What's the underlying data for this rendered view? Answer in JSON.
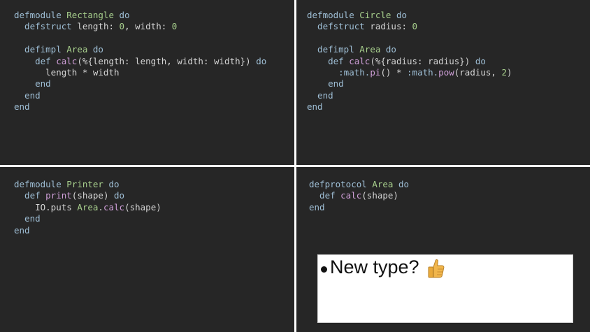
{
  "panes": {
    "top_left": {
      "lines": [
        [
          {
            "t": "defmodule ",
            "c": "k"
          },
          {
            "t": "Rectangle",
            "c": "m"
          },
          {
            "t": " do",
            "c": "k"
          }
        ],
        [
          {
            "t": "  defstruct ",
            "c": "k"
          },
          {
            "t": "length: ",
            "c": "t"
          },
          {
            "t": "0",
            "c": "n"
          },
          {
            "t": ", width: ",
            "c": "t"
          },
          {
            "t": "0",
            "c": "n"
          }
        ],
        [],
        [
          {
            "t": "  defimpl ",
            "c": "k"
          },
          {
            "t": "Area",
            "c": "m"
          },
          {
            "t": " do",
            "c": "k"
          }
        ],
        [
          {
            "t": "    def ",
            "c": "k"
          },
          {
            "t": "calc",
            "c": "f"
          },
          {
            "t": "(%{length: length, width: width}) ",
            "c": "t"
          },
          {
            "t": "do",
            "c": "k"
          }
        ],
        [
          {
            "t": "      length * width",
            "c": "t"
          }
        ],
        [
          {
            "t": "    end",
            "c": "k"
          }
        ],
        [
          {
            "t": "  end",
            "c": "k"
          }
        ],
        [
          {
            "t": "end",
            "c": "k"
          }
        ]
      ]
    },
    "top_right": {
      "lines": [
        [
          {
            "t": "defmodule ",
            "c": "k"
          },
          {
            "t": "Circle",
            "c": "m"
          },
          {
            "t": " do",
            "c": "k"
          }
        ],
        [
          {
            "t": "  defstruct ",
            "c": "k"
          },
          {
            "t": "radius: ",
            "c": "t"
          },
          {
            "t": "0",
            "c": "n"
          }
        ],
        [],
        [
          {
            "t": "  defimpl ",
            "c": "k"
          },
          {
            "t": "Area",
            "c": "m"
          },
          {
            "t": " do",
            "c": "k"
          }
        ],
        [
          {
            "t": "    def ",
            "c": "k"
          },
          {
            "t": "calc",
            "c": "f"
          },
          {
            "t": "(%{radius: radius}) ",
            "c": "t"
          },
          {
            "t": "do",
            "c": "k"
          }
        ],
        [
          {
            "t": "      :math.",
            "c": "k"
          },
          {
            "t": "pi",
            "c": "f"
          },
          {
            "t": "() * ",
            "c": "t"
          },
          {
            "t": ":math.",
            "c": "k"
          },
          {
            "t": "pow",
            "c": "f"
          },
          {
            "t": "(radius, ",
            "c": "t"
          },
          {
            "t": "2",
            "c": "n"
          },
          {
            "t": ")",
            "c": "t"
          }
        ],
        [
          {
            "t": "    end",
            "c": "k"
          }
        ],
        [
          {
            "t": "  end",
            "c": "k"
          }
        ],
        [
          {
            "t": "end",
            "c": "k"
          }
        ]
      ]
    },
    "bottom_left": {
      "lines": [
        [
          {
            "t": "defmodule ",
            "c": "k"
          },
          {
            "t": "Printer",
            "c": "m"
          },
          {
            "t": " do",
            "c": "k"
          }
        ],
        [
          {
            "t": "  def ",
            "c": "k"
          },
          {
            "t": "print",
            "c": "f"
          },
          {
            "t": "(shape) ",
            "c": "t"
          },
          {
            "t": "do",
            "c": "k"
          }
        ],
        [
          {
            "t": "    IO",
            "c": "t"
          },
          {
            "t": ".puts ",
            "c": "t"
          },
          {
            "t": "Area",
            "c": "m"
          },
          {
            "t": ".",
            "c": "t"
          },
          {
            "t": "calc",
            "c": "f"
          },
          {
            "t": "(shape)",
            "c": "t"
          }
        ],
        [
          {
            "t": "  end",
            "c": "k"
          }
        ],
        [
          {
            "t": "end",
            "c": "k"
          }
        ]
      ]
    },
    "bottom_right": {
      "lines": [
        [
          {
            "t": "defprotocol ",
            "c": "k"
          },
          {
            "t": "Area",
            "c": "m"
          },
          {
            "t": " do",
            "c": "k"
          }
        ],
        [
          {
            "t": "  def ",
            "c": "k"
          },
          {
            "t": "calc",
            "c": "f"
          },
          {
            "t": "(shape)",
            "c": "t"
          }
        ],
        [
          {
            "t": "end",
            "c": "k"
          }
        ]
      ]
    }
  },
  "note": {
    "text": "New type?",
    "icon": "thumbs-up-icon"
  },
  "colors": {
    "background": "#262626",
    "keyword": "#9fbfd6",
    "module": "#a8d08d",
    "function": "#cf9fd8",
    "text": "#d4d4d4",
    "number": "#a8d08d"
  }
}
